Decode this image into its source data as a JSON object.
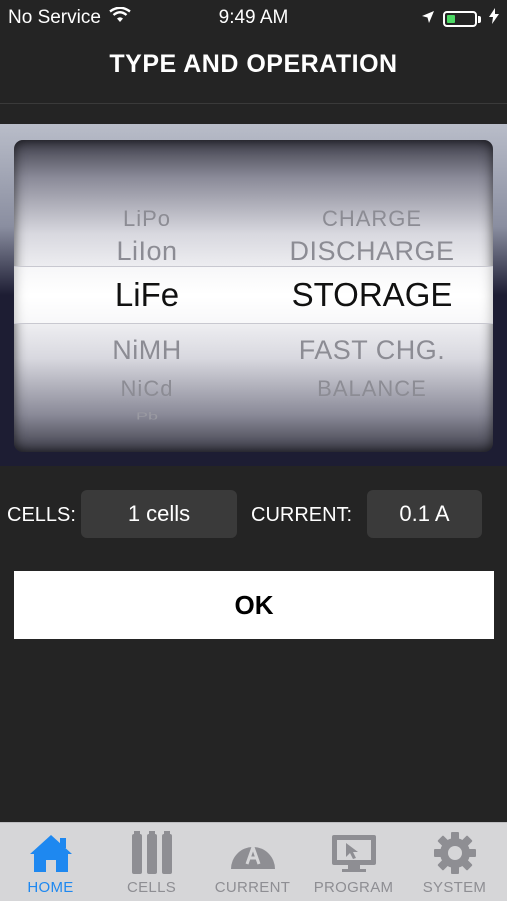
{
  "status_bar": {
    "carrier": "No Service",
    "time": "9:49 AM"
  },
  "header": {
    "title": "TYPE AND OPERATION"
  },
  "picker": {
    "types": [
      "LiPo",
      "LiIon",
      "LiFe",
      "NiMH",
      "NiCd",
      "Pb"
    ],
    "operations": [
      "CHARGE",
      "DISCHARGE",
      "STORAGE",
      "FAST CHG.",
      "BALANCE"
    ],
    "selected_type": "LiFe",
    "selected_operation": "STORAGE"
  },
  "settings": {
    "cells_label": "CELLS:",
    "cells_value": "1 cells",
    "current_label": "CURRENT:",
    "current_value": "0.1 A"
  },
  "actions": {
    "ok_label": "OK"
  },
  "tab_bar": {
    "tabs": [
      {
        "label": "HOME",
        "icon": "home-icon",
        "active": true
      },
      {
        "label": "CELLS",
        "icon": "cells-icon",
        "active": false
      },
      {
        "label": "CURRENT",
        "icon": "gauge-icon",
        "active": false
      },
      {
        "label": "PROGRAM",
        "icon": "monitor-icon",
        "active": false
      },
      {
        "label": "SYSTEM",
        "icon": "gear-icon",
        "active": false
      }
    ]
  },
  "colors": {
    "active_tab": "#1e88f0",
    "inactive_tab": "#8e8e93",
    "battery": "#4cd964"
  },
  "battery_level": 0.3
}
